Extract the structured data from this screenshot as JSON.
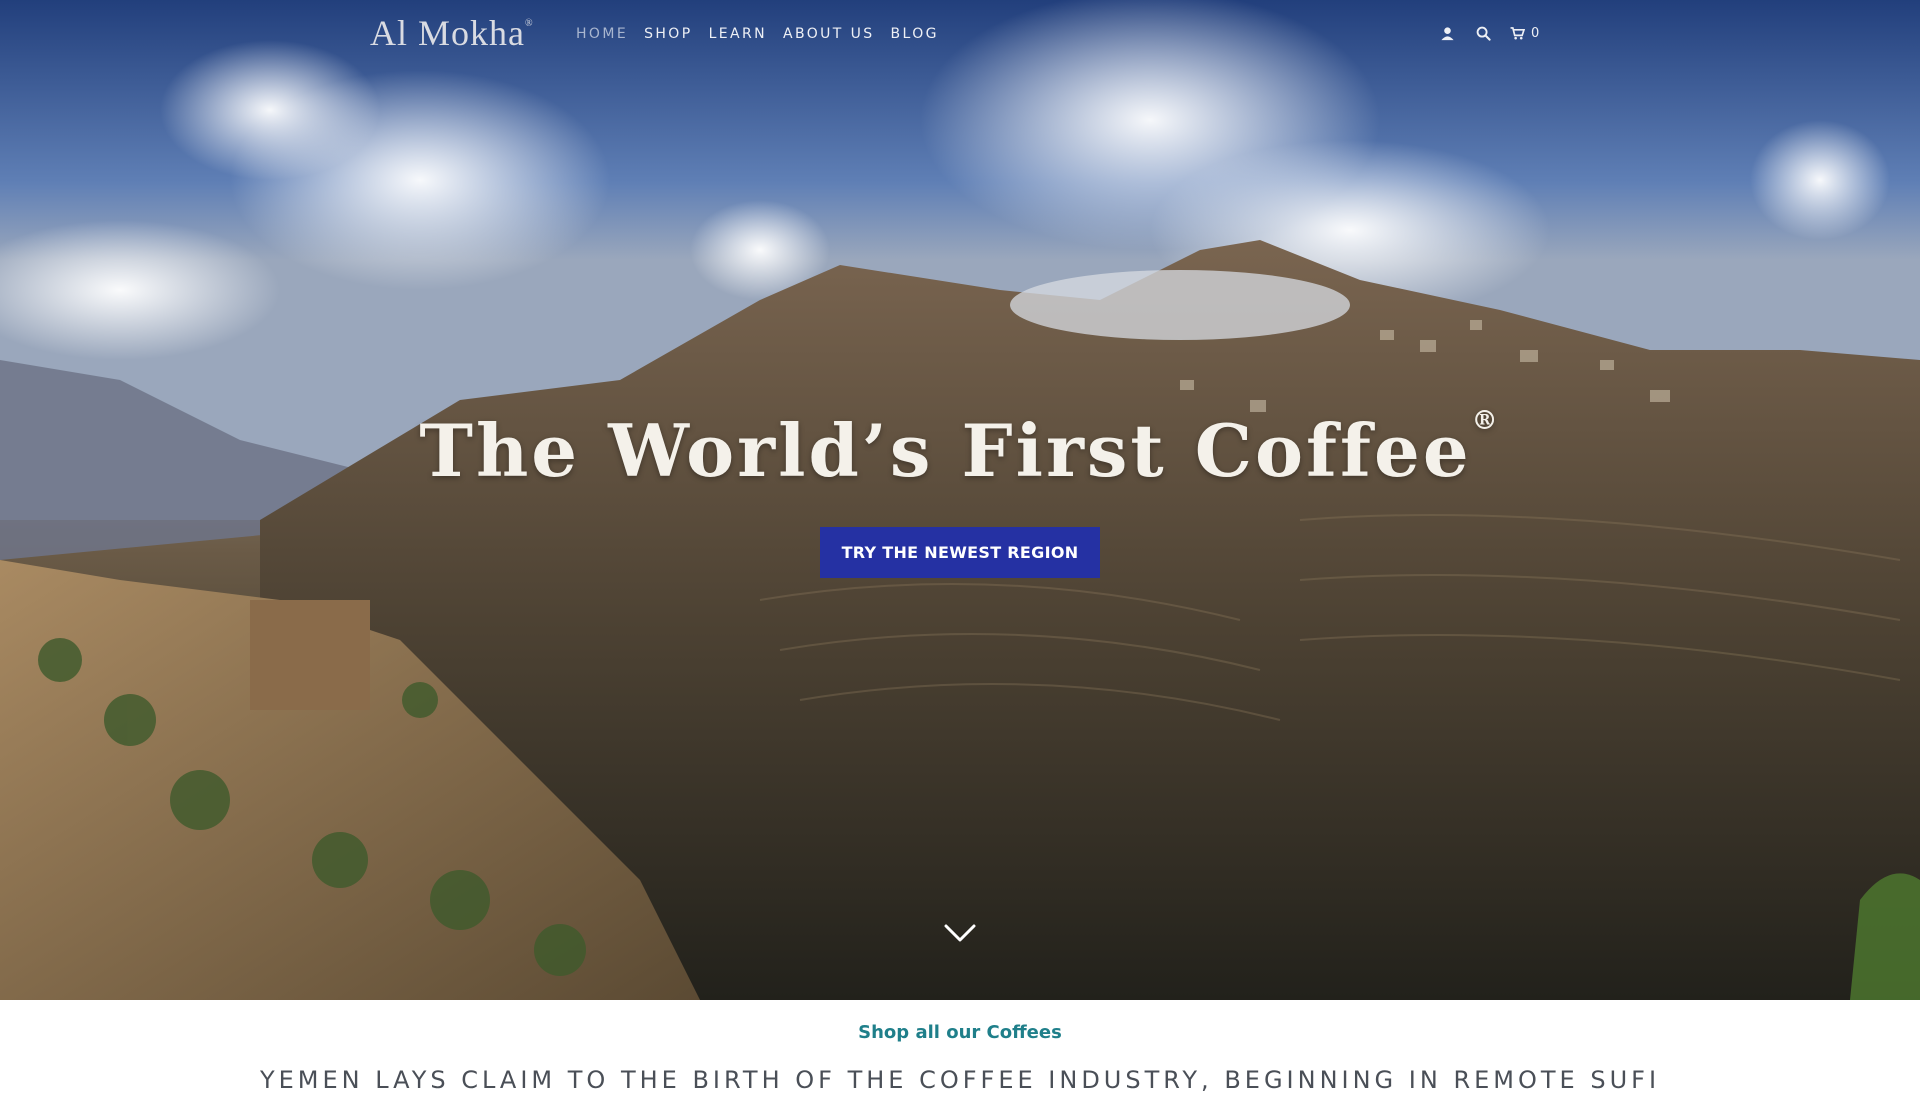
{
  "brand": {
    "logo_text": "Al Mokha",
    "logo_mark": "®"
  },
  "nav": {
    "items": [
      {
        "label": "HOME",
        "active": true
      },
      {
        "label": "SHOP",
        "active": false
      },
      {
        "label": "LEARN",
        "active": false
      },
      {
        "label": "ABOUT US",
        "active": false
      },
      {
        "label": "BLOG",
        "active": false
      }
    ],
    "icons": [
      "user-icon",
      "search-icon",
      "cart-icon"
    ],
    "cart_count": "0"
  },
  "hero": {
    "headline": "The World’s First Coffee",
    "headline_mark": "®",
    "cta_label": "TRY THE NEWEST REGION",
    "scroll_icon": "chevron-down-icon"
  },
  "section": {
    "shop_link": "Shop all our Coffees",
    "intro_text": "YEMEN LAYS CLAIM TO THE BIRTH OF THE COFFEE INDUSTRY, BEGINNING IN REMOTE SUFI"
  },
  "colors": {
    "cta_bg": "#2531a3",
    "link": "#1f7f8a",
    "nav_active": "#a9b6cf"
  }
}
